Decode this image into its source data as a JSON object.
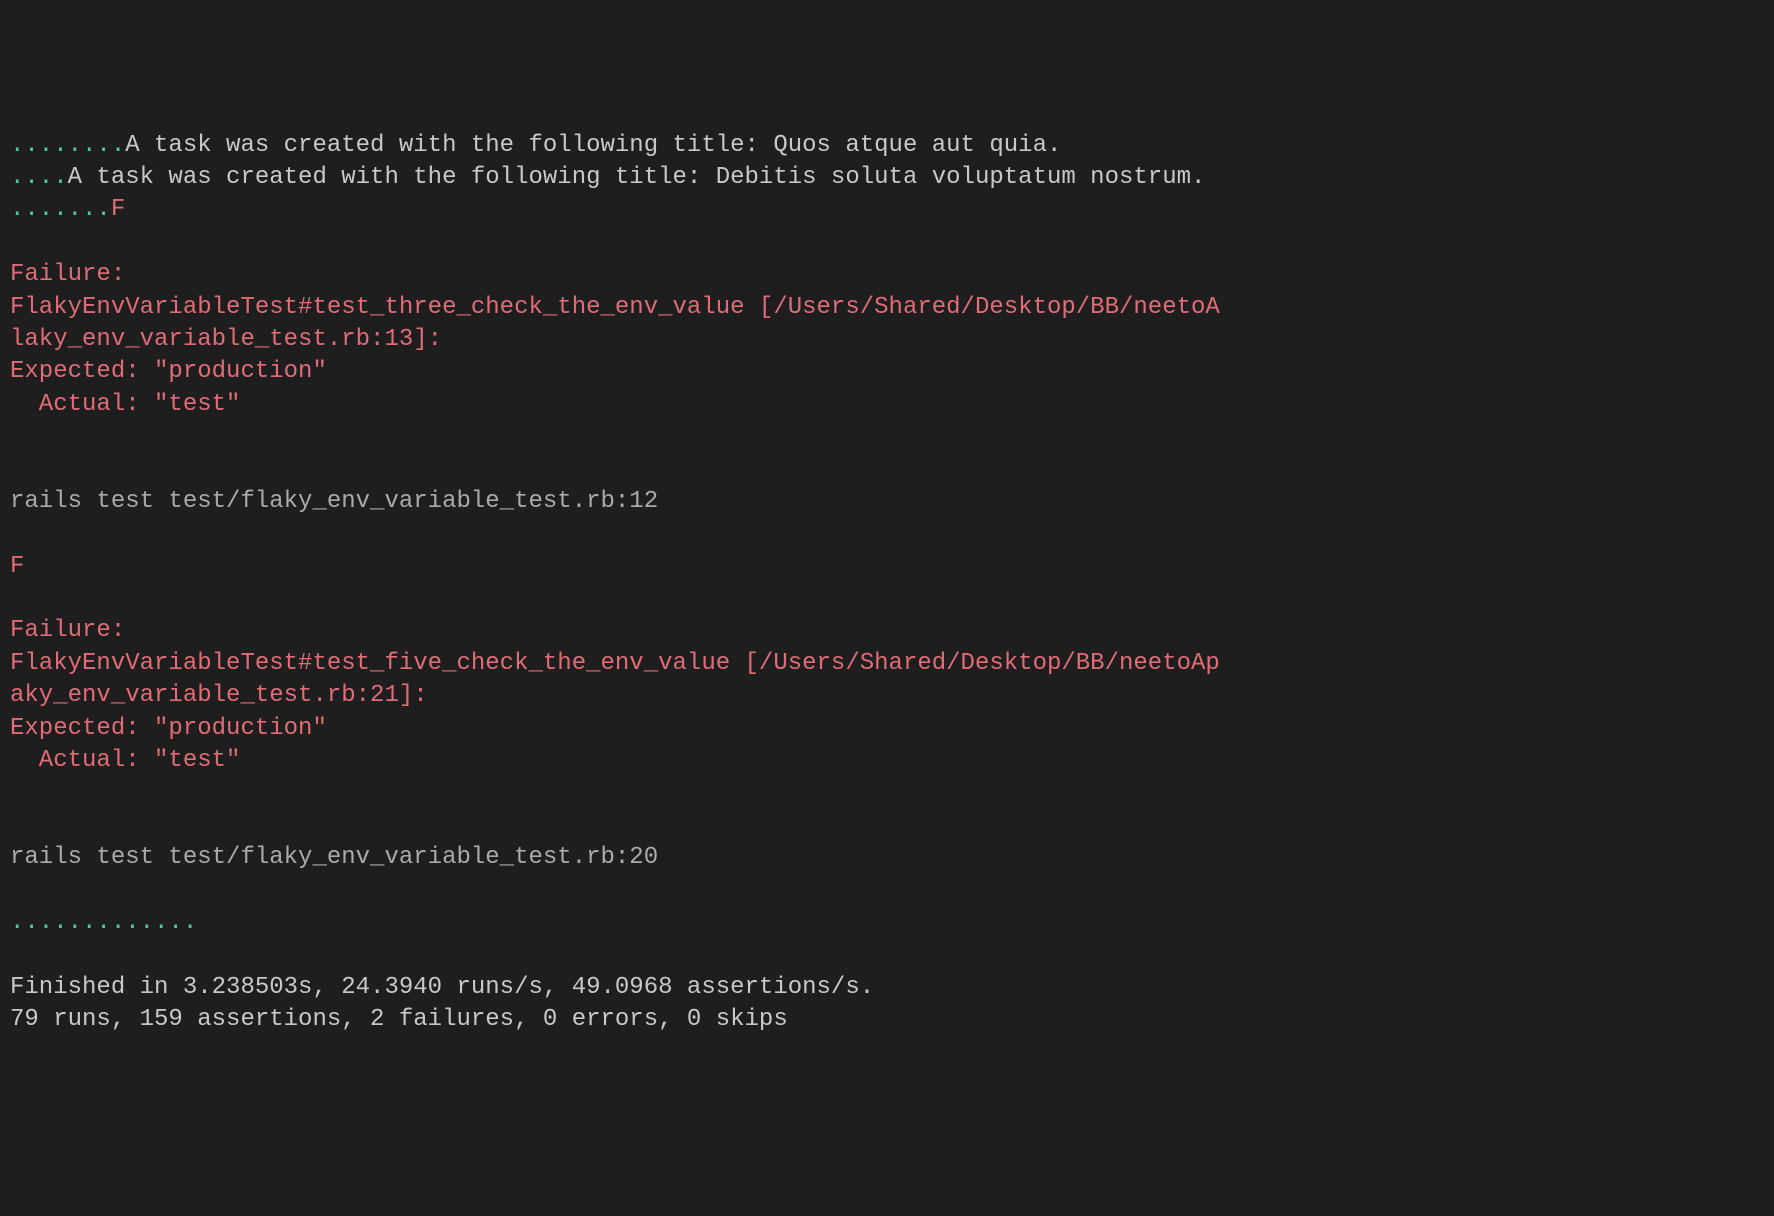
{
  "terminal": {
    "line1_dots": "........",
    "line1_text": "A task was created with the following title: Quos atque aut quia.",
    "line2_dots": "....",
    "line2_text": "A task was created with the following title: Debitis soluta voluptatum nostrum.",
    "line3_dots": ".......",
    "line3_f": "F",
    "failure1_header": "Failure:",
    "failure1_test": "FlakyEnvVariableTest#test_three_check_the_env_value [/Users/Shared/Desktop/BB/neetoA",
    "failure1_file": "laky_env_variable_test.rb:13]:",
    "failure1_expected": "Expected: \"production\"",
    "failure1_actual": "  Actual: \"test\"",
    "rails_test1": "rails test test/flaky_env_variable_test.rb:12",
    "f_marker": "F",
    "failure2_header": "Failure:",
    "failure2_test": "FlakyEnvVariableTest#test_five_check_the_env_value [/Users/Shared/Desktop/BB/neetoAp",
    "failure2_file": "aky_env_variable_test.rb:21]:",
    "failure2_expected": "Expected: \"production\"",
    "failure2_actual": "  Actual: \"test\"",
    "rails_test2": "rails test test/flaky_env_variable_test.rb:20",
    "final_dots": ".............",
    "finished_line": "Finished in 3.238503s, 24.3940 runs/s, 49.0968 assertions/s.",
    "summary_line": "79 runs, 159 assertions, 2 failures, 0 errors, 0 skips"
  }
}
